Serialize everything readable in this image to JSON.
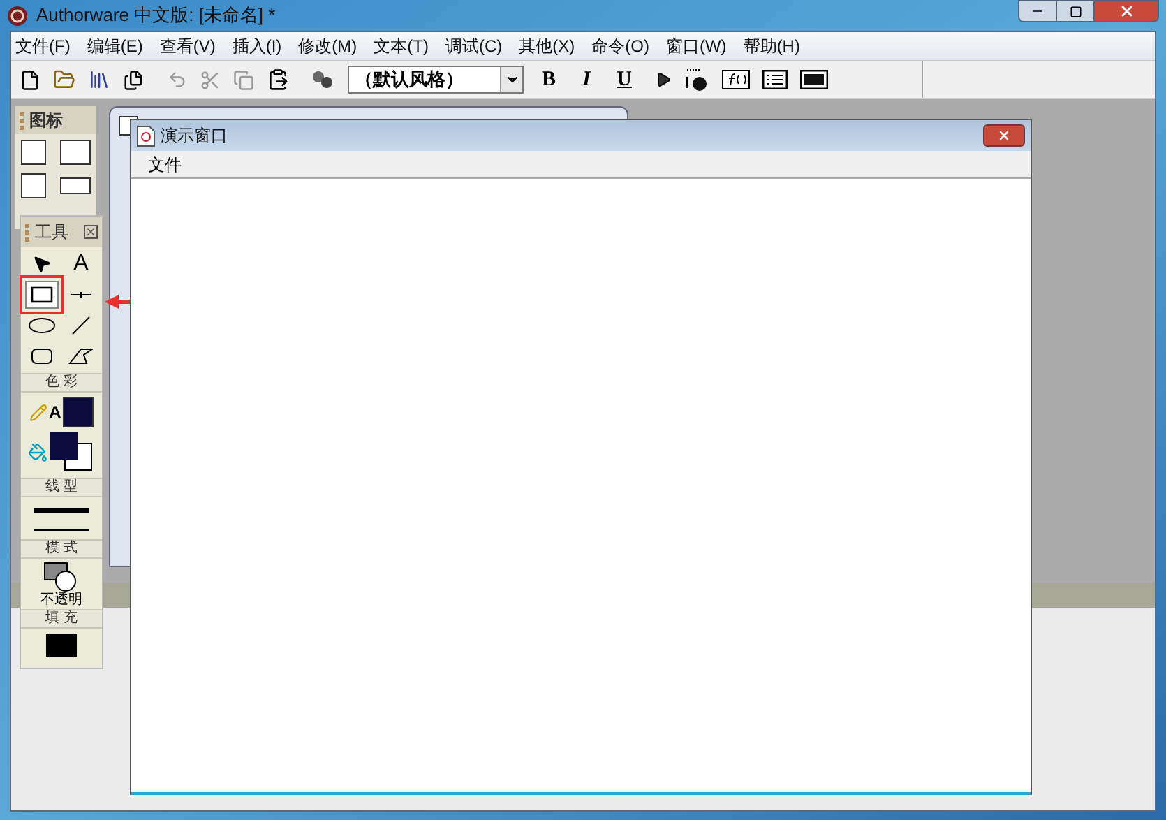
{
  "window": {
    "title": "Authorware 中文版: [未命名] *"
  },
  "menu": [
    "文件(F)",
    "编辑(E)",
    "查看(V)",
    "插入(I)",
    "修改(M)",
    "文本(T)",
    "调试(C)",
    "其他(X)",
    "命令(O)",
    "窗口(W)",
    "帮助(H)"
  ],
  "toolbar": {
    "style_dropdown": {
      "value": "（默认风格）"
    },
    "format_buttons": [
      {
        "label": "B",
        "kind": "bold"
      },
      {
        "label": "I",
        "kind": "italic"
      },
      {
        "label": "U",
        "kind": "underline"
      }
    ]
  },
  "icons_palette": {
    "title": "图标"
  },
  "tools_palette": {
    "title": "工具",
    "tools": [
      {
        "kind": "pointer",
        "selected": false
      },
      {
        "kind": "text",
        "label": "A",
        "selected": false
      },
      {
        "kind": "rectangle",
        "selected": true
      },
      {
        "kind": "orthogonal-line",
        "selected": false
      },
      {
        "kind": "ellipse",
        "selected": false
      },
      {
        "kind": "diagonal-line",
        "selected": false
      },
      {
        "kind": "rounded-rectangle",
        "selected": false
      },
      {
        "kind": "polygon",
        "selected": false
      }
    ],
    "color_section": {
      "label": "色 彩",
      "line_text_label": "A"
    },
    "line_section": {
      "label": "线 型"
    },
    "mode_section": {
      "label": "模 式",
      "mode": "不透明"
    },
    "fill_section": {
      "label": "填 充"
    }
  },
  "presentation_window": {
    "title": "演示窗口",
    "menu": [
      "文件"
    ]
  }
}
